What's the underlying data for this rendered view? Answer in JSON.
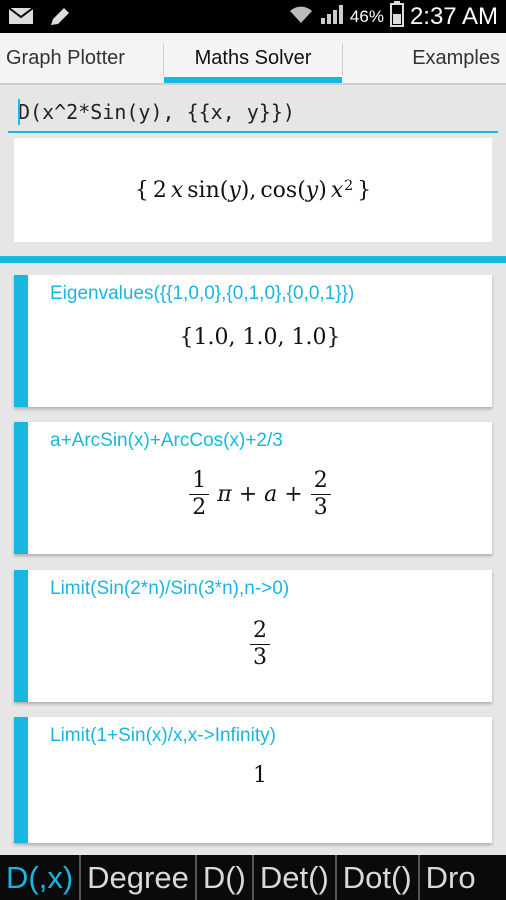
{
  "status_bar": {
    "battery_percent": "46%",
    "time": "2:37 AM",
    "icons": [
      "mail-icon",
      "pencil-icon",
      "wifi-icon",
      "signal-icon",
      "battery-icon"
    ]
  },
  "tabs": [
    {
      "label": "Graph Plotter",
      "active": false
    },
    {
      "label": "Maths Solver",
      "active": true
    },
    {
      "label": "Examples",
      "active": false
    }
  ],
  "input": {
    "value": "D(x^2*Sin(y), {{x, y}})"
  },
  "current_result": {
    "open": "{",
    "t1": "2",
    "t1b": "x",
    "t1c": "sin(",
    "t1d": "y",
    "t1e": "),",
    "t2": "cos(",
    "t2b": "y",
    "t2c": ")",
    "t2d": "x",
    "t2sup": "2",
    "close": "}"
  },
  "history": [
    {
      "expression": "Eigenvalues({{1,0,0},{0,1,0},{0,0,1}})",
      "result": "{1.0, 1.0, 1.0}"
    },
    {
      "expression": "a+ArcSin(x)+ArcCos(x)+2/3",
      "result": {
        "frac1_num": "1",
        "frac1_den": "2",
        "middle": "π + a +",
        "frac2_num": "2",
        "frac2_den": "3"
      }
    },
    {
      "expression": "Limit(Sin(2*n)/Sin(3*n),n->0)",
      "result": {
        "num": "2",
        "den": "3"
      }
    },
    {
      "expression": "Limit(1+Sin(x)/x,x->Infinity)",
      "result": "1"
    }
  ],
  "suggestions": [
    "D(,x)",
    "Degree",
    "D()",
    "Det()",
    "Dot()",
    "Dro"
  ],
  "colors": {
    "accent": "#17b7e0",
    "background": "#e6e6e6",
    "suggestion_bar": "#0a0a0a"
  }
}
